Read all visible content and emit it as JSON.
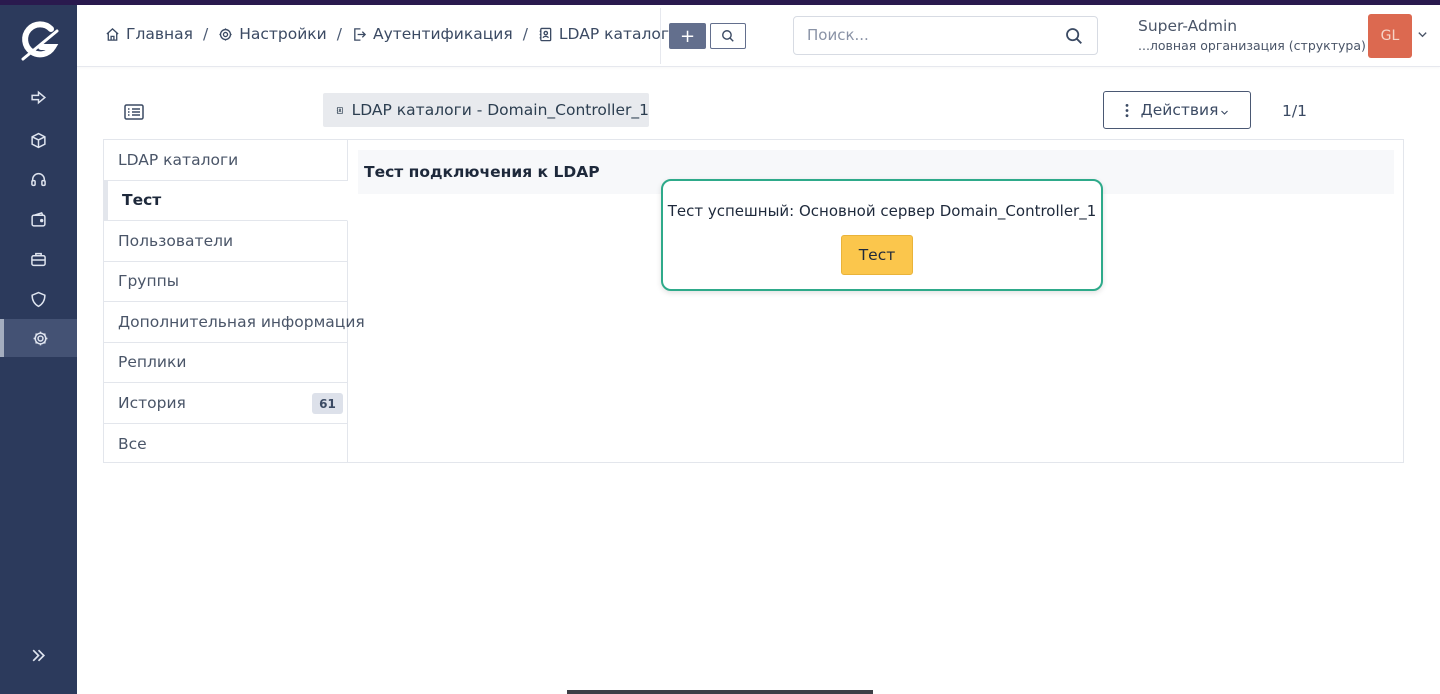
{
  "breadcrumb": [
    {
      "label": "Главная",
      "icon": "home-icon"
    },
    {
      "label": "Настройки",
      "icon": "gear-icon"
    },
    {
      "label": "Аутентификация",
      "icon": "login-icon"
    },
    {
      "label": "LDAP каталоги",
      "icon": "address-book-icon"
    }
  ],
  "breadcrumb_separator": "/",
  "header": {
    "add_label": "+",
    "search_placeholder": "Поиск...",
    "user_name": "Super-Admin",
    "user_org": "...ловная организация (структура)",
    "avatar_initials": "GL"
  },
  "record": {
    "title": "LDAP каталоги - Domain_Controller_1",
    "actions_label": "Действия",
    "pager": "1/1"
  },
  "tabs": [
    {
      "label": "LDAP каталоги"
    },
    {
      "label": "Тест"
    },
    {
      "label": "Пользователи"
    },
    {
      "label": "Группы"
    },
    {
      "label": "Дополнительная информация"
    },
    {
      "label": "Реплики"
    },
    {
      "label": "История",
      "badge": "61"
    },
    {
      "label": "Все"
    }
  ],
  "content": {
    "title": "Тест подключения к LDAP",
    "result_message": "Тест успешный: Основной сервер Domain_Controller_1",
    "test_button": "Тест"
  },
  "colors": {
    "sidebar": "#2c3a5c",
    "success_border": "#2eaa8a",
    "test_button": "#fbc64c",
    "avatar": "#dc6950"
  },
  "sidebar_icons": [
    "logout-arrow-icon",
    "box-icon",
    "headset-icon",
    "wallet-icon",
    "briefcase-icon",
    "shield-icon",
    "gear-icon",
    "double-chevron-right-icon"
  ]
}
